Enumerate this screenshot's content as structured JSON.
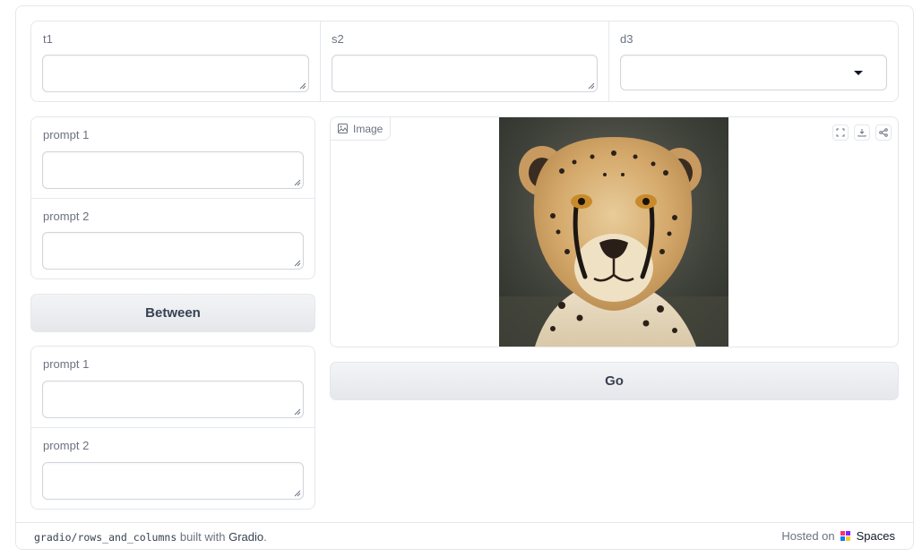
{
  "top_row": {
    "t1": {
      "label": "t1",
      "value": ""
    },
    "s2": {
      "label": "s2",
      "value": ""
    },
    "d3": {
      "label": "d3",
      "selected": ""
    }
  },
  "left_column": {
    "group1": {
      "prompt1_label": "prompt 1",
      "prompt2_label": "prompt 2"
    },
    "between_button": "Between",
    "group2": {
      "prompt1_label": "prompt 1",
      "prompt2_label": "prompt 2"
    }
  },
  "image_panel": {
    "label": "Image",
    "tools": [
      "fullscreen-icon",
      "download-icon",
      "share-icon"
    ]
  },
  "go_button": "Go",
  "footer": {
    "repo": "gradio/rows_and_columns",
    "built_with": "built with",
    "gradio": "Gradio",
    "hosted_on": "Hosted on",
    "spaces": "Spaces"
  }
}
